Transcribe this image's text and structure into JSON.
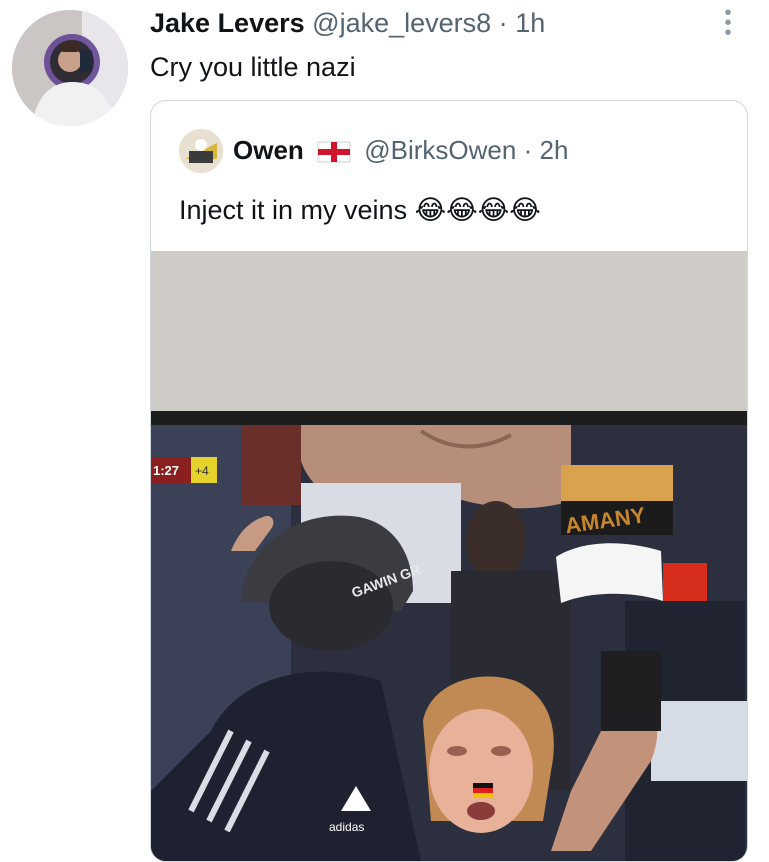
{
  "tweet": {
    "author_name": "Jake Levers",
    "handle": "@jake_levers8",
    "separator": "·",
    "time": "1h",
    "text": "Cry you little nazi"
  },
  "more_icon": "more-dots-icon",
  "quoted_tweet": {
    "author_name": "Owen",
    "flag_icon": "england-flag-icon",
    "handle": "@BirksOwen",
    "separator": "·",
    "time": "2h",
    "text": "Inject it in my veins",
    "emoji": "😂😂😂😂",
    "image": {
      "tv_score": "1:27",
      "tv_added": "+4",
      "scarf_text": "AMANY",
      "cap_text": "GAWIN GR",
      "shirt_brand": "adidas"
    }
  },
  "colors": {
    "text": "#0f1419",
    "muted": "#536471",
    "border": "#cfd9de"
  }
}
